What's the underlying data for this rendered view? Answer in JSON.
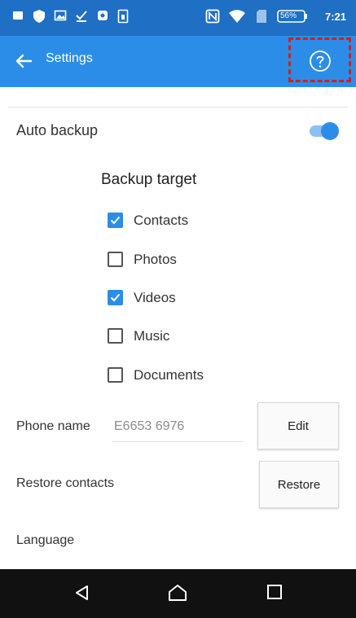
{
  "status_bar": {
    "battery": "56%",
    "time": "7:21"
  },
  "app_bar": {
    "title": "Settings"
  },
  "settings": {
    "auto_backup_label": "Auto backup",
    "auto_backup_on": true,
    "backup_target_title": "Backup target",
    "targets": [
      {
        "label": "Contacts",
        "checked": true
      },
      {
        "label": "Photos",
        "checked": false
      },
      {
        "label": "Videos",
        "checked": true
      },
      {
        "label": "Music",
        "checked": false
      },
      {
        "label": "Documents",
        "checked": false
      }
    ],
    "phone_name_label": "Phone name",
    "phone_name_value": "E6653 6976",
    "edit_button": "Edit",
    "restore_contacts_label": "Restore contacts",
    "restore_button": "Restore",
    "language_label": "Language"
  },
  "colors": {
    "app_bar": "#2b8de8",
    "status_bar": "#1f6fc4",
    "accent": "#2b8de8",
    "highlight_dash": "#d21f1f"
  }
}
